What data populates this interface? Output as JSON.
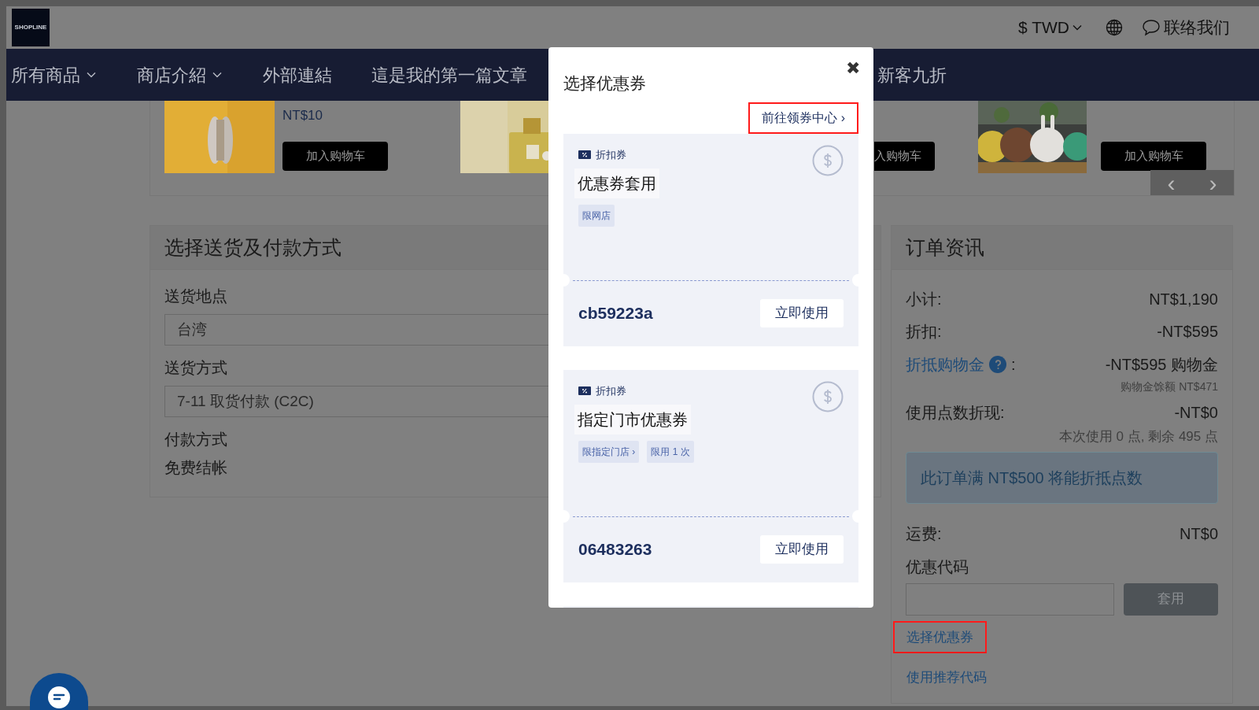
{
  "header": {
    "logo": "SHOPLINE",
    "currency": "$ TWD",
    "contact": "联络我们"
  },
  "nav": [
    {
      "label": "所有商品",
      "dropdown": true
    },
    {
      "label": "商店介紹",
      "dropdown": true
    },
    {
      "label": "外部連結",
      "dropdown": false
    },
    {
      "label": "這是我的第一篇文章",
      "dropdown": false
    },
    {
      "label": "新客九折",
      "dropdown": false
    }
  ],
  "carousel": {
    "items": [
      {
        "kind": "picture"
      },
      {
        "kind": "info",
        "price": "NT$10",
        "button": "加入购物车"
      },
      {
        "kind": "picture"
      },
      {
        "kind": "info",
        "button": "入购物车"
      },
      {
        "kind": "picture"
      },
      {
        "kind": "info",
        "button": "加入购物车"
      }
    ],
    "prev": "‹",
    "next": "›"
  },
  "shipping": {
    "title": "选择送货及付款方式",
    "fields": [
      {
        "label": "送货地点",
        "value": "台湾"
      },
      {
        "label": "送货方式",
        "value": "7-11 取货付款 (C2C)"
      }
    ],
    "payment_label": "付款方式",
    "payment_value": "免费结帐"
  },
  "order": {
    "title": "订单资讯",
    "rows": [
      {
        "kind": "plain",
        "label": "小计:",
        "value": "NT$1,190"
      },
      {
        "kind": "plain",
        "label": "折扣:",
        "value": "-NT$595"
      },
      {
        "kind": "link",
        "label": "折抵购物金",
        "colon": ":",
        "value": "-NT$595 购物金",
        "note": "购物金馀额 NT$471"
      },
      {
        "kind": "plain",
        "label": "使用点数折现:",
        "value": "-NT$0",
        "note": "本次使用 0 点, 剩余 495 点"
      }
    ],
    "notice": "此订单满 NT$500 将能折抵点数",
    "shipping_fee": {
      "label": "运费:",
      "value": "NT$0"
    },
    "promo_label": "优惠代码",
    "apply_button": "套用",
    "links": [
      {
        "label": "选择优惠券",
        "highlighted": true
      },
      {
        "label": "使用推荐代码",
        "highlighted": false
      }
    ]
  },
  "modal": {
    "title": "选择优惠券",
    "close": "✖",
    "center_link": {
      "label": "前往领券中心 ›",
      "highlighted": true
    },
    "coupons": [
      {
        "type": "折扣券",
        "title": "优惠券套用",
        "tags": [
          "限网店"
        ],
        "code": "cb59223a",
        "button": "立即使用"
      },
      {
        "type": "折扣券",
        "title": "指定门市优惠券",
        "tags": [
          "限指定门店 ›",
          "限用 1 次"
        ],
        "code": "06483263",
        "button": "立即使用"
      }
    ]
  }
}
